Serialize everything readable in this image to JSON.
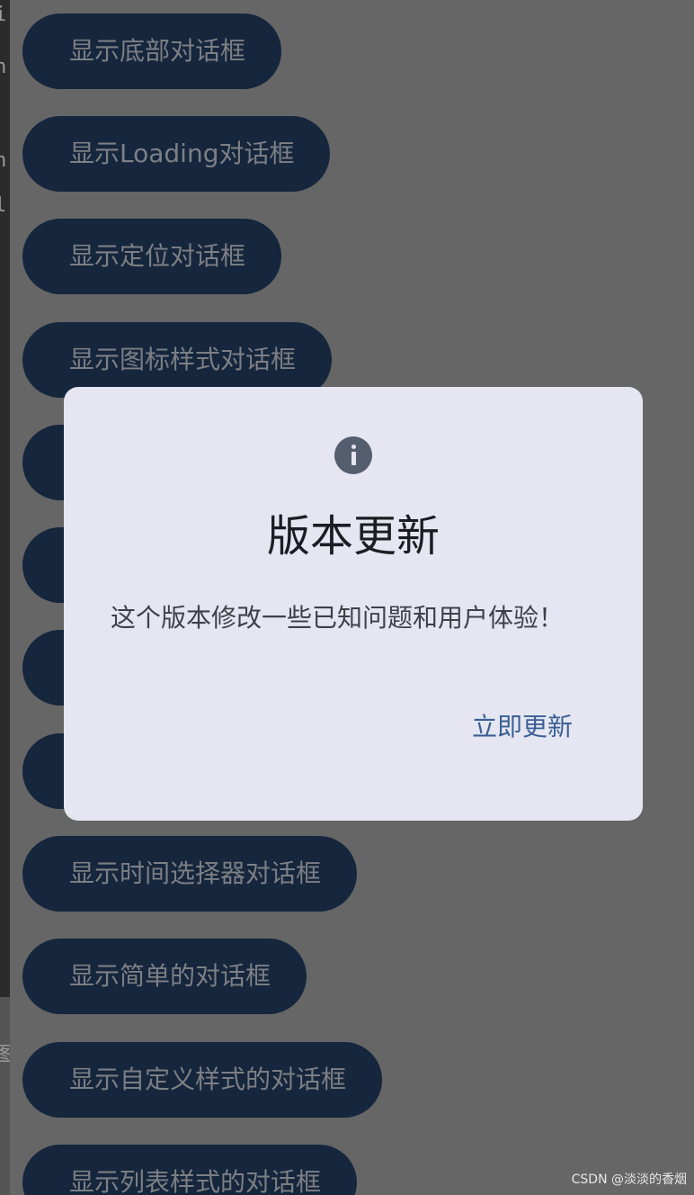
{
  "ide_fragment": {
    "chars": [
      "i",
      "n",
      "h",
      "l",
      "图"
    ]
  },
  "buttons": [
    {
      "label": "显示底部对话框"
    },
    {
      "label": "显示Loading对话框"
    },
    {
      "label": "显示定位对话框"
    },
    {
      "label": "显示图标样式对话框"
    },
    {
      "label": ""
    },
    {
      "label": ""
    },
    {
      "label": ""
    },
    {
      "label": ""
    },
    {
      "label": "显示时间选择器对话框"
    },
    {
      "label": "显示简单的对话框"
    },
    {
      "label": "显示自定义样式的对话框"
    },
    {
      "label": "显示列表样式的对话框"
    }
  ],
  "dialog": {
    "icon": "info-icon",
    "title": "版本更新",
    "message": "这个版本修改一些已知问题和用户体验！",
    "action": "立即更新"
  },
  "watermark": "CSDN @淡淡的香烟",
  "colors": {
    "scrim": "#666666",
    "button_bg": "#15263d",
    "dialog_bg": "#e5e6f2",
    "action_text": "#3a5f93",
    "icon_bg": "#545e6f"
  }
}
